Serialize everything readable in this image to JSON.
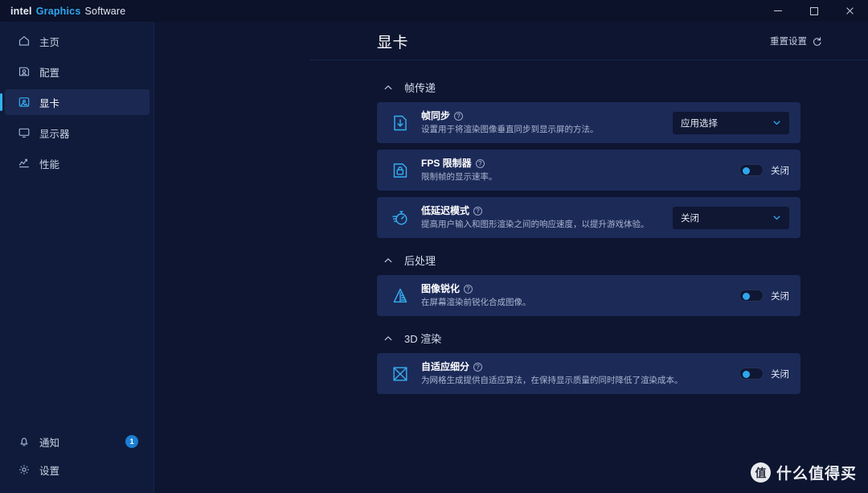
{
  "window": {
    "brand_intel": "intel",
    "brand_graphics": "Graphics",
    "brand_software": "Software",
    "minimize_label": "minimize",
    "maximize_label": "maximize",
    "close_label": "close",
    "accent_color": "#2ea7ef",
    "titlebar_bg": "#0b1229",
    "sidebar_bg": "#101b3b",
    "page_bg": "#0d1530",
    "card_bg": "#1c2a58"
  },
  "sidebar": {
    "items": [
      {
        "label": "主页",
        "icon": "home-icon",
        "active": false
      },
      {
        "label": "配置",
        "icon": "profile-icon",
        "active": false
      },
      {
        "label": "显卡",
        "icon": "graphics-card-icon",
        "active": true
      },
      {
        "label": "显示器",
        "icon": "monitor-icon",
        "active": false
      },
      {
        "label": "性能",
        "icon": "performance-icon",
        "active": false
      }
    ],
    "bottom_items": [
      {
        "label": "通知",
        "icon": "bell-icon",
        "badge": "1"
      },
      {
        "label": "设置",
        "icon": "gear-icon",
        "badge": ""
      }
    ]
  },
  "header": {
    "title": "显卡",
    "reset_label": "重置设置",
    "reset_icon": "refresh-icon"
  },
  "sections": [
    {
      "title": "帧传递",
      "collapse_icon": "chevron-up-icon",
      "rows": [
        {
          "icon": "frame-sync-icon",
          "title": "帧同步",
          "help_icon": "help-icon",
          "desc": "设置用于将渲染图像垂直同步到显示屏的方法。",
          "control": "dropdown",
          "value": "应用选择",
          "chevron_icon": "chevron-down-icon"
        },
        {
          "icon": "fps-lock-icon",
          "title": "FPS 限制器",
          "help_icon": "help-icon",
          "desc": "限制帧的显示速率。",
          "control": "toggle",
          "value": "关闭",
          "on": false
        },
        {
          "icon": "stopwatch-icon",
          "title": "低延迟模式",
          "help_icon": "help-icon",
          "desc": "提高用户输入和图形渲染之间的响应速度，以提升游戏体验。",
          "control": "dropdown",
          "value": "关闭",
          "chevron_icon": "chevron-down-icon"
        }
      ]
    },
    {
      "title": "后处理",
      "collapse_icon": "chevron-up-icon",
      "rows": [
        {
          "icon": "sharpening-icon",
          "title": "图像锐化",
          "help_icon": "help-icon",
          "desc": "在屏幕渲染前锐化合成图像。",
          "control": "toggle",
          "value": "关闭",
          "on": false
        }
      ]
    },
    {
      "title": "3D 渲染",
      "collapse_icon": "chevron-up-icon",
      "rows": [
        {
          "icon": "tessellation-icon",
          "title": "自适应细分",
          "help_icon": "help-icon",
          "desc": "为网格生成提供自适应算法，在保持显示质量的同时降低了渲染成本。",
          "control": "toggle",
          "value": "关闭",
          "on": false
        }
      ]
    }
  ],
  "watermark": {
    "logo": "值",
    "text": "什么值得买"
  }
}
